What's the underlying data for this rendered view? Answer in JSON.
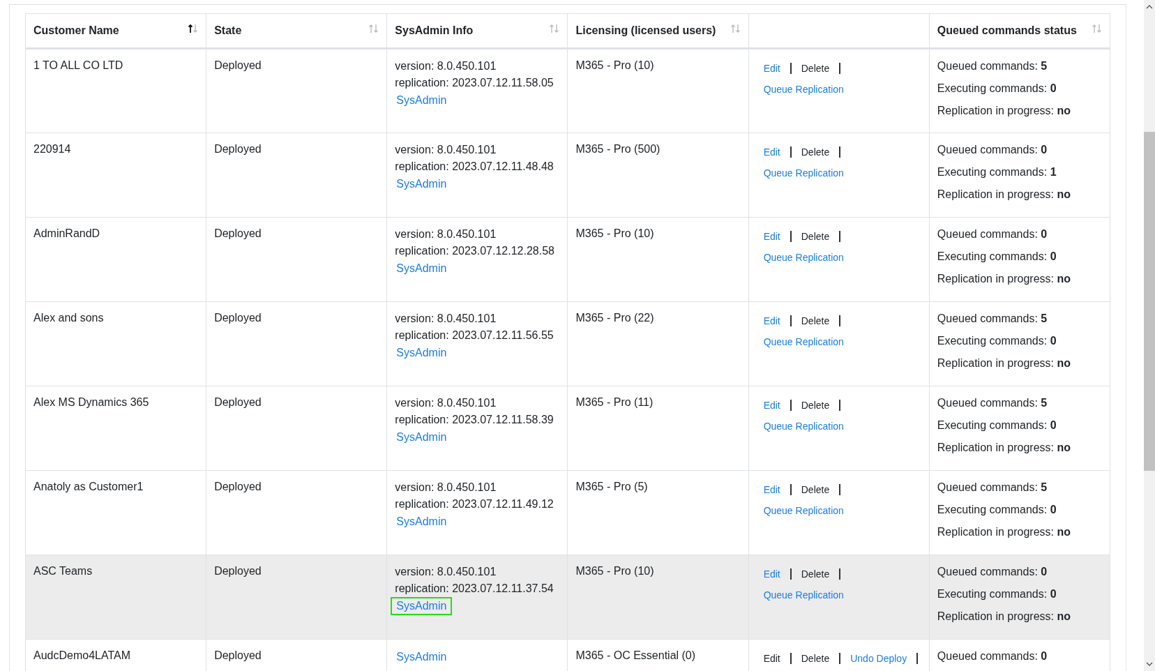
{
  "table": {
    "columns": [
      {
        "label": "Customer Name",
        "sortable": true,
        "sorted": true
      },
      {
        "label": "State",
        "sortable": true,
        "sorted": false
      },
      {
        "label": "SysAdmin Info",
        "sortable": true,
        "sorted": false
      },
      {
        "label": "Licensing (licensed users)",
        "sortable": true,
        "sorted": false
      },
      {
        "sortable": false
      },
      {
        "label": "Queued commands status",
        "sortable": true,
        "sorted": false
      }
    ],
    "rows": [
      {
        "customer": "1 TO ALL CO LTD",
        "state": "Deployed",
        "info": [
          "version: 8.0.450.101",
          "replication: 2023.07.12.11.58.05"
        ],
        "sysadmin": {
          "label": "SysAdmin",
          "focused": false
        },
        "licensing": "M365 - Pro (10)",
        "actions": [
          {
            "label": "Edit",
            "kind": "link"
          },
          {
            "label": "Delete",
            "kind": "plain"
          }
        ],
        "queue_replication": "Queue Replication",
        "status": [
          {
            "label": "Queued commands:",
            "value": "5"
          },
          {
            "label": "Executing commands:",
            "value": "0"
          },
          {
            "label": "Replication in progress:",
            "value": "no"
          }
        ],
        "selected": false
      },
      {
        "customer": "220914",
        "state": "Deployed",
        "info": [
          "version: 8.0.450.101",
          "replication: 2023.07.12.11.48.48"
        ],
        "sysadmin": {
          "label": "SysAdmin",
          "focused": false
        },
        "licensing": "M365 - Pro (500)",
        "actions": [
          {
            "label": "Edit",
            "kind": "link"
          },
          {
            "label": "Delete",
            "kind": "plain"
          }
        ],
        "queue_replication": "Queue Replication",
        "status": [
          {
            "label": "Queued commands:",
            "value": "0"
          },
          {
            "label": "Executing commands:",
            "value": "1"
          },
          {
            "label": "Replication in progress:",
            "value": "no"
          }
        ],
        "selected": false
      },
      {
        "customer": "AdminRandD",
        "state": "Deployed",
        "info": [
          "version: 8.0.450.101",
          "replication: 2023.07.12.12.28.58"
        ],
        "sysadmin": {
          "label": "SysAdmin",
          "focused": false
        },
        "licensing": "M365 - Pro (10)",
        "actions": [
          {
            "label": "Edit",
            "kind": "link"
          },
          {
            "label": "Delete",
            "kind": "plain"
          }
        ],
        "queue_replication": "Queue Replication",
        "status": [
          {
            "label": "Queued commands:",
            "value": "0"
          },
          {
            "label": "Executing commands:",
            "value": "0"
          },
          {
            "label": "Replication in progress:",
            "value": "no"
          }
        ],
        "selected": false
      },
      {
        "customer": "Alex and sons",
        "state": "Deployed",
        "info": [
          "version: 8.0.450.101",
          "replication: 2023.07.12.11.56.55"
        ],
        "sysadmin": {
          "label": "SysAdmin",
          "focused": false
        },
        "licensing": "M365 - Pro (22)",
        "actions": [
          {
            "label": "Edit",
            "kind": "link"
          },
          {
            "label": "Delete",
            "kind": "plain"
          }
        ],
        "queue_replication": "Queue Replication",
        "status": [
          {
            "label": "Queued commands:",
            "value": "5"
          },
          {
            "label": "Executing commands:",
            "value": "0"
          },
          {
            "label": "Replication in progress:",
            "value": "no"
          }
        ],
        "selected": false
      },
      {
        "customer": "Alex MS Dynamics 365",
        "state": "Deployed",
        "info": [
          "version: 8.0.450.101",
          "replication: 2023.07.12.11.58.39"
        ],
        "sysadmin": {
          "label": "SysAdmin",
          "focused": false
        },
        "licensing": "M365 - Pro (11)",
        "actions": [
          {
            "label": "Edit",
            "kind": "link"
          },
          {
            "label": "Delete",
            "kind": "plain"
          }
        ],
        "queue_replication": "Queue Replication",
        "status": [
          {
            "label": "Queued commands:",
            "value": "5"
          },
          {
            "label": "Executing commands:",
            "value": "0"
          },
          {
            "label": "Replication in progress:",
            "value": "no"
          }
        ],
        "selected": false
      },
      {
        "customer": "Anatoly as Customer1",
        "state": "Deployed",
        "info": [
          "version: 8.0.450.101",
          "replication: 2023.07.12.11.49.12"
        ],
        "sysadmin": {
          "label": "SysAdmin",
          "focused": false
        },
        "licensing": "M365 - Pro (5)",
        "actions": [
          {
            "label": "Edit",
            "kind": "link"
          },
          {
            "label": "Delete",
            "kind": "plain"
          }
        ],
        "queue_replication": "Queue Replication",
        "status": [
          {
            "label": "Queued commands:",
            "value": "5"
          },
          {
            "label": "Executing commands:",
            "value": "0"
          },
          {
            "label": "Replication in progress:",
            "value": "no"
          }
        ],
        "selected": false
      },
      {
        "customer": "ASC Teams",
        "state": "Deployed",
        "info": [
          "version: 8.0.450.101",
          "replication: 2023.07.12.11.37.54"
        ],
        "sysadmin": {
          "label": "SysAdmin",
          "focused": true
        },
        "licensing": "M365 - Pro (10)",
        "actions": [
          {
            "label": "Edit",
            "kind": "link"
          },
          {
            "label": "Delete",
            "kind": "plain"
          }
        ],
        "queue_replication": "Queue Replication",
        "status": [
          {
            "label": "Queued commands:",
            "value": "0"
          },
          {
            "label": "Executing commands:",
            "value": "0"
          },
          {
            "label": "Replication in progress:",
            "value": "no"
          }
        ],
        "selected": true
      },
      {
        "customer": "AudcDemo4LATAM",
        "state": "Deployed",
        "sysadmin": {
          "label": "SysAdmin",
          "focused": false
        },
        "licensing": "M365 - OC Essential (0)",
        "actions": [
          {
            "label": "Edit",
            "kind": "plain"
          },
          {
            "label": "Delete",
            "kind": "plain"
          },
          {
            "label": "Undo Deploy",
            "kind": "link"
          }
        ],
        "status": [
          {
            "label": "Queued commands:",
            "value": "0"
          }
        ],
        "selected": false
      }
    ]
  }
}
